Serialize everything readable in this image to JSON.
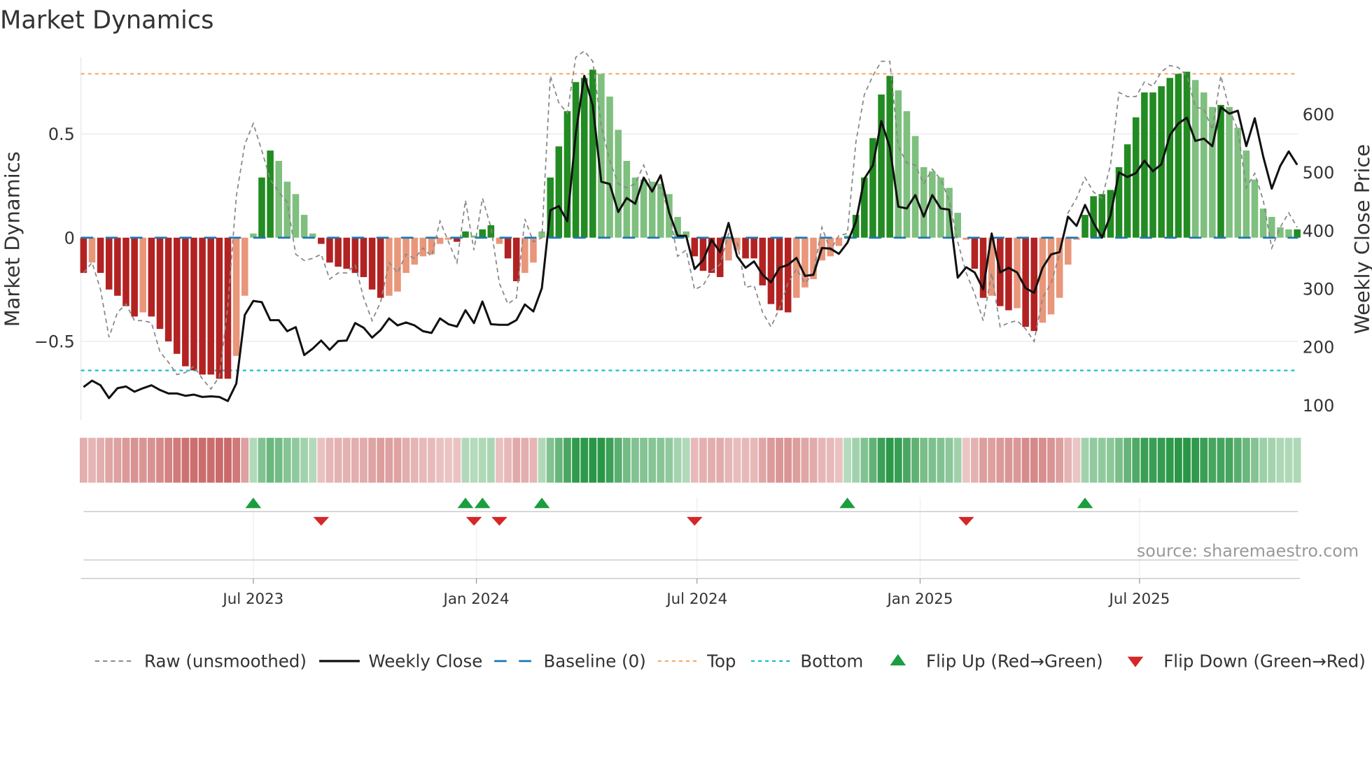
{
  "title": "Market Dynamics",
  "source": "source: sharemaestro.com",
  "colors": {
    "rising_green": "#228b22",
    "fading_green": "#7fbf7f",
    "falling_red": "#b22222",
    "recovering_red": "#e9967a",
    "price": "#111111",
    "raw": "#888888",
    "baseline": "#1f77b4",
    "top": "#f4a460",
    "bottom": "#17becf",
    "flip_up": "#1a9e3f",
    "flip_down": "#d62728"
  },
  "chart_data": {
    "type": "bar",
    "title": "Market Dynamics",
    "ylabel": "Market Dynamics",
    "ylabel_right": "Weekly Close Price",
    "ylim": [
      -0.88,
      0.87
    ],
    "ylim_right": [
      74,
      698
    ],
    "yticks": [
      {
        "value": 0.5,
        "label": "0.5"
      },
      {
        "value": 0,
        "label": "0"
      },
      {
        "value": -0.5,
        "label": "−0.5"
      }
    ],
    "yticks_right": [
      {
        "value": 600,
        "label": "600"
      },
      {
        "value": 500,
        "label": "500"
      },
      {
        "value": 400,
        "label": "400"
      },
      {
        "value": 300,
        "label": "300"
      },
      {
        "value": 200,
        "label": "200"
      },
      {
        "value": 100,
        "label": "100"
      }
    ],
    "first_week": "2023-02-11",
    "xticks": [
      {
        "label": "Jul 2023",
        "date": "2023-07-01"
      },
      {
        "label": "Jan 2024",
        "date": "2024-01-01"
      },
      {
        "label": "Jul 2024",
        "date": "2024-07-01"
      },
      {
        "label": "Jan 2025",
        "date": "2025-01-01"
      },
      {
        "label": "Jul 2025",
        "date": "2025-07-01"
      }
    ],
    "top_level": 0.79,
    "bottom_level": -0.64,
    "baseline": 0,
    "momentum": [
      -0.17,
      -0.12,
      -0.17,
      -0.25,
      -0.28,
      -0.33,
      -0.38,
      -0.36,
      -0.38,
      -0.44,
      -0.5,
      -0.56,
      -0.62,
      -0.64,
      -0.66,
      -0.66,
      -0.68,
      -0.68,
      -0.57,
      -0.28,
      0.02,
      0.29,
      0.42,
      0.37,
      0.27,
      0.21,
      0.11,
      0.02,
      -0.03,
      -0.12,
      -0.14,
      -0.15,
      -0.17,
      -0.19,
      -0.25,
      -0.29,
      -0.28,
      -0.26,
      -0.17,
      -0.13,
      -0.09,
      -0.08,
      -0.03,
      -0.01,
      -0.02,
      0.03,
      0.01,
      0.04,
      0.06,
      -0.03,
      -0.1,
      -0.21,
      -0.17,
      -0.12,
      0.03,
      0.29,
      0.44,
      0.61,
      0.75,
      0.77,
      0.81,
      0.79,
      0.68,
      0.52,
      0.37,
      0.29,
      0.28,
      0.27,
      0.26,
      0.21,
      0.1,
      0.03,
      -0.09,
      -0.16,
      -0.17,
      -0.19,
      -0.11,
      -0.06,
      -0.1,
      -0.1,
      -0.23,
      -0.32,
      -0.35,
      -0.36,
      -0.29,
      -0.24,
      -0.2,
      -0.11,
      -0.09,
      -0.04,
      0.01,
      0.11,
      0.29,
      0.48,
      0.69,
      0.78,
      0.71,
      0.61,
      0.49,
      0.34,
      0.32,
      0.29,
      0.24,
      0.12,
      -0.01,
      -0.15,
      -0.29,
      -0.28,
      -0.33,
      -0.35,
      -0.34,
      -0.43,
      -0.45,
      -0.41,
      -0.37,
      -0.29,
      -0.13,
      -0.01,
      0.11,
      0.2,
      0.21,
      0.23,
      0.34,
      0.45,
      0.58,
      0.7,
      0.7,
      0.73,
      0.77,
      0.79,
      0.8,
      0.76,
      0.7,
      0.63,
      0.64,
      0.63,
      0.53,
      0.42,
      0.28,
      0.14,
      0.1,
      0.05,
      0.04,
      0.04
    ],
    "raw": [
      -0.17,
      -0.12,
      -0.25,
      -0.48,
      -0.36,
      -0.32,
      -0.4,
      -0.4,
      -0.41,
      -0.55,
      -0.6,
      -0.66,
      -0.65,
      -0.62,
      -0.68,
      -0.73,
      -0.67,
      -0.33,
      0.2,
      0.45,
      0.55,
      0.42,
      0.28,
      0.22,
      0.17,
      -0.08,
      -0.11,
      -0.1,
      -0.08,
      -0.2,
      -0.17,
      -0.17,
      -0.13,
      -0.29,
      -0.4,
      -0.31,
      -0.12,
      -0.17,
      -0.08,
      -0.1,
      -0.05,
      -0.09,
      0.08,
      -0.02,
      -0.12,
      0.18,
      -0.06,
      0.19,
      0.05,
      -0.22,
      -0.32,
      -0.29,
      0.09,
      -0.02,
      0.0,
      0.78,
      0.65,
      0.6,
      0.87,
      0.9,
      0.85,
      0.54,
      0.37,
      0.26,
      0.24,
      0.26,
      0.35,
      0.24,
      0.24,
      0.12,
      -0.09,
      -0.06,
      -0.25,
      -0.23,
      -0.16,
      -0.13,
      0.02,
      -0.02,
      -0.24,
      -0.23,
      -0.36,
      -0.43,
      -0.34,
      -0.22,
      -0.15,
      -0.22,
      -0.17,
      0.05,
      -0.06,
      0.01,
      0.02,
      0.46,
      0.69,
      0.78,
      0.85,
      0.85,
      0.44,
      0.36,
      0.35,
      0.26,
      0.33,
      0.28,
      0.18,
      -0.02,
      -0.17,
      -0.27,
      -0.4,
      -0.17,
      -0.43,
      -0.41,
      -0.4,
      -0.44,
      -0.5,
      -0.29,
      -0.22,
      -0.08,
      0.12,
      0.19,
      0.29,
      0.22,
      0.19,
      0.35,
      0.7,
      0.68,
      0.68,
      0.75,
      0.73,
      0.8,
      0.83,
      0.82,
      0.78,
      0.63,
      0.62,
      0.52,
      0.78,
      0.62,
      0.52,
      0.24,
      0.31,
      0.18,
      -0.05,
      0.05,
      0.12,
      0.05
    ],
    "weekly_close": [
      131,
      142,
      134,
      112,
      129,
      132,
      123,
      129,
      134,
      126,
      120,
      120,
      116,
      118,
      114,
      115,
      114,
      107,
      137,
      255,
      279,
      277,
      246,
      246,
      227,
      234,
      186,
      197,
      211,
      195,
      210,
      211,
      241,
      233,
      216,
      229,
      249,
      237,
      242,
      237,
      227,
      224,
      249,
      239,
      235,
      263,
      241,
      278,
      239,
      238,
      238,
      246,
      273,
      261,
      301,
      435,
      442,
      416,
      567,
      666,
      615,
      484,
      480,
      432,
      456,
      446,
      491,
      467,
      495,
      431,
      391,
      391,
      334,
      349,
      384,
      363,
      413,
      356,
      336,
      347,
      324,
      311,
      336,
      341,
      353,
      322,
      324,
      370,
      369,
      360,
      379,
      415,
      489,
      512,
      588,
      543,
      441,
      438,
      461,
      424,
      461,
      438,
      436,
      319,
      337,
      328,
      299,
      395,
      328,
      336,
      328,
      301,
      293,
      336,
      359,
      363,
      424,
      408,
      444,
      413,
      388,
      426,
      500,
      492,
      499,
      520,
      502,
      514,
      564,
      584,
      594,
      554,
      558,
      545,
      612,
      601,
      606,
      545,
      593,
      527,
      472,
      511,
      536,
      513
    ],
    "flip_up_weeks": [
      20,
      45,
      47,
      54,
      90,
      118
    ],
    "flip_down_weeks": [
      28,
      46,
      49,
      72,
      104
    ],
    "legend_position": "bottom",
    "legend": [
      {
        "label": "Raw (unsmoothed)",
        "kind": "raw"
      },
      {
        "label": "Weekly Close",
        "kind": "price"
      },
      {
        "label": "Baseline (0)",
        "kind": "baseline"
      },
      {
        "label": "Top",
        "kind": "top"
      },
      {
        "label": "Bottom",
        "kind": "bottom"
      },
      {
        "label": "Flip Up (Red→Green)",
        "kind": "flip_up"
      },
      {
        "label": "Flip Down (Green→Red)",
        "kind": "flip_down"
      }
    ]
  }
}
